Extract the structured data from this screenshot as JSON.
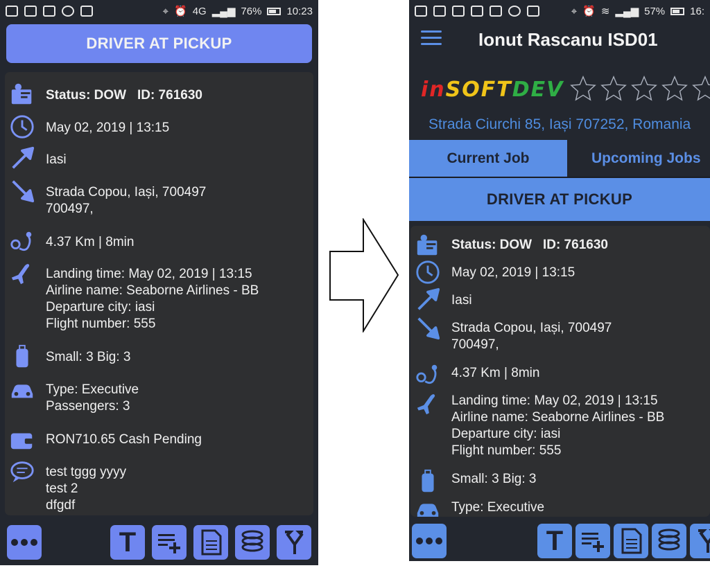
{
  "left": {
    "statusbar": {
      "network": "4G",
      "battery": "76%",
      "time": "10:23"
    },
    "pickup_label": "DRIVER AT PICKUP",
    "status": "Status: DOW",
    "job_id": "ID: 761630",
    "datetime": "May 02, 2019 | 13:15",
    "pickup": "Iasi",
    "dropoff_line1": "Strada Copou, Iași, 700497",
    "dropoff_line2": "700497,",
    "distance": "4.37 Km | 8min",
    "flight": {
      "landing": "Landing time: May 02, 2019 | 13:15",
      "airline": "Airline name: Seaborne Airlines - BB",
      "departure": "Departure city: iasi",
      "number": "Flight number: 555"
    },
    "luggage": "Small: 3  Big: 3",
    "vehicle_type": "Type: Executive",
    "passengers": "Passengers: 3",
    "payment": "RON710.65  Cash  Pending",
    "notes": [
      "test tggg yyyy",
      "test 2",
      "dfgdf"
    ]
  },
  "right": {
    "statusbar": {
      "battery": "57%",
      "time": "16:"
    },
    "driver_name": "Ionut Rascanu ISD01",
    "brand": [
      "in",
      "SOFT",
      "DEV"
    ],
    "rating": 0,
    "address": "Strada Ciurchi 85, Iași 707252, Romania",
    "tabs": [
      "Current Job",
      "Upcoming Jobs"
    ],
    "pickup_label": "DRIVER AT PICKUP",
    "status": "Status: DOW",
    "job_id": "ID: 761630",
    "datetime": "May 02, 2019 | 13:15",
    "pickup": "Iasi",
    "dropoff_line1": "Strada Copou, Iași, 700497",
    "dropoff_line2": "700497,",
    "distance": "4.37 Km | 8min",
    "flight": {
      "landing": "Landing time: May 02, 2019 | 13:15",
      "airline": "Airline name: Seaborne Airlines - BB",
      "departure": "Departure city: iasi",
      "number": "Flight number: 555"
    },
    "luggage": "Small: 3  Big: 3",
    "vehicle_type": "Type: Executive"
  },
  "icons": {
    "status": "id-card-icon",
    "time": "clock-icon",
    "pickup": "arrow-up-right-icon",
    "dropoff": "arrow-down-right-icon",
    "distance": "route-icon",
    "flight": "airplane-icon",
    "luggage": "suitcase-icon",
    "vehicle": "car-icon",
    "payment": "wallet-icon",
    "notes": "chat-icon",
    "bottom": [
      "more-icon",
      "text-icon",
      "add-note-icon",
      "document-icon",
      "coins-icon",
      "route-fork-icon"
    ]
  },
  "colors": {
    "accent_left": "#6f86f0",
    "accent_right": "#5b8fe6",
    "background": "#23272f",
    "card": "#2e2f31"
  }
}
